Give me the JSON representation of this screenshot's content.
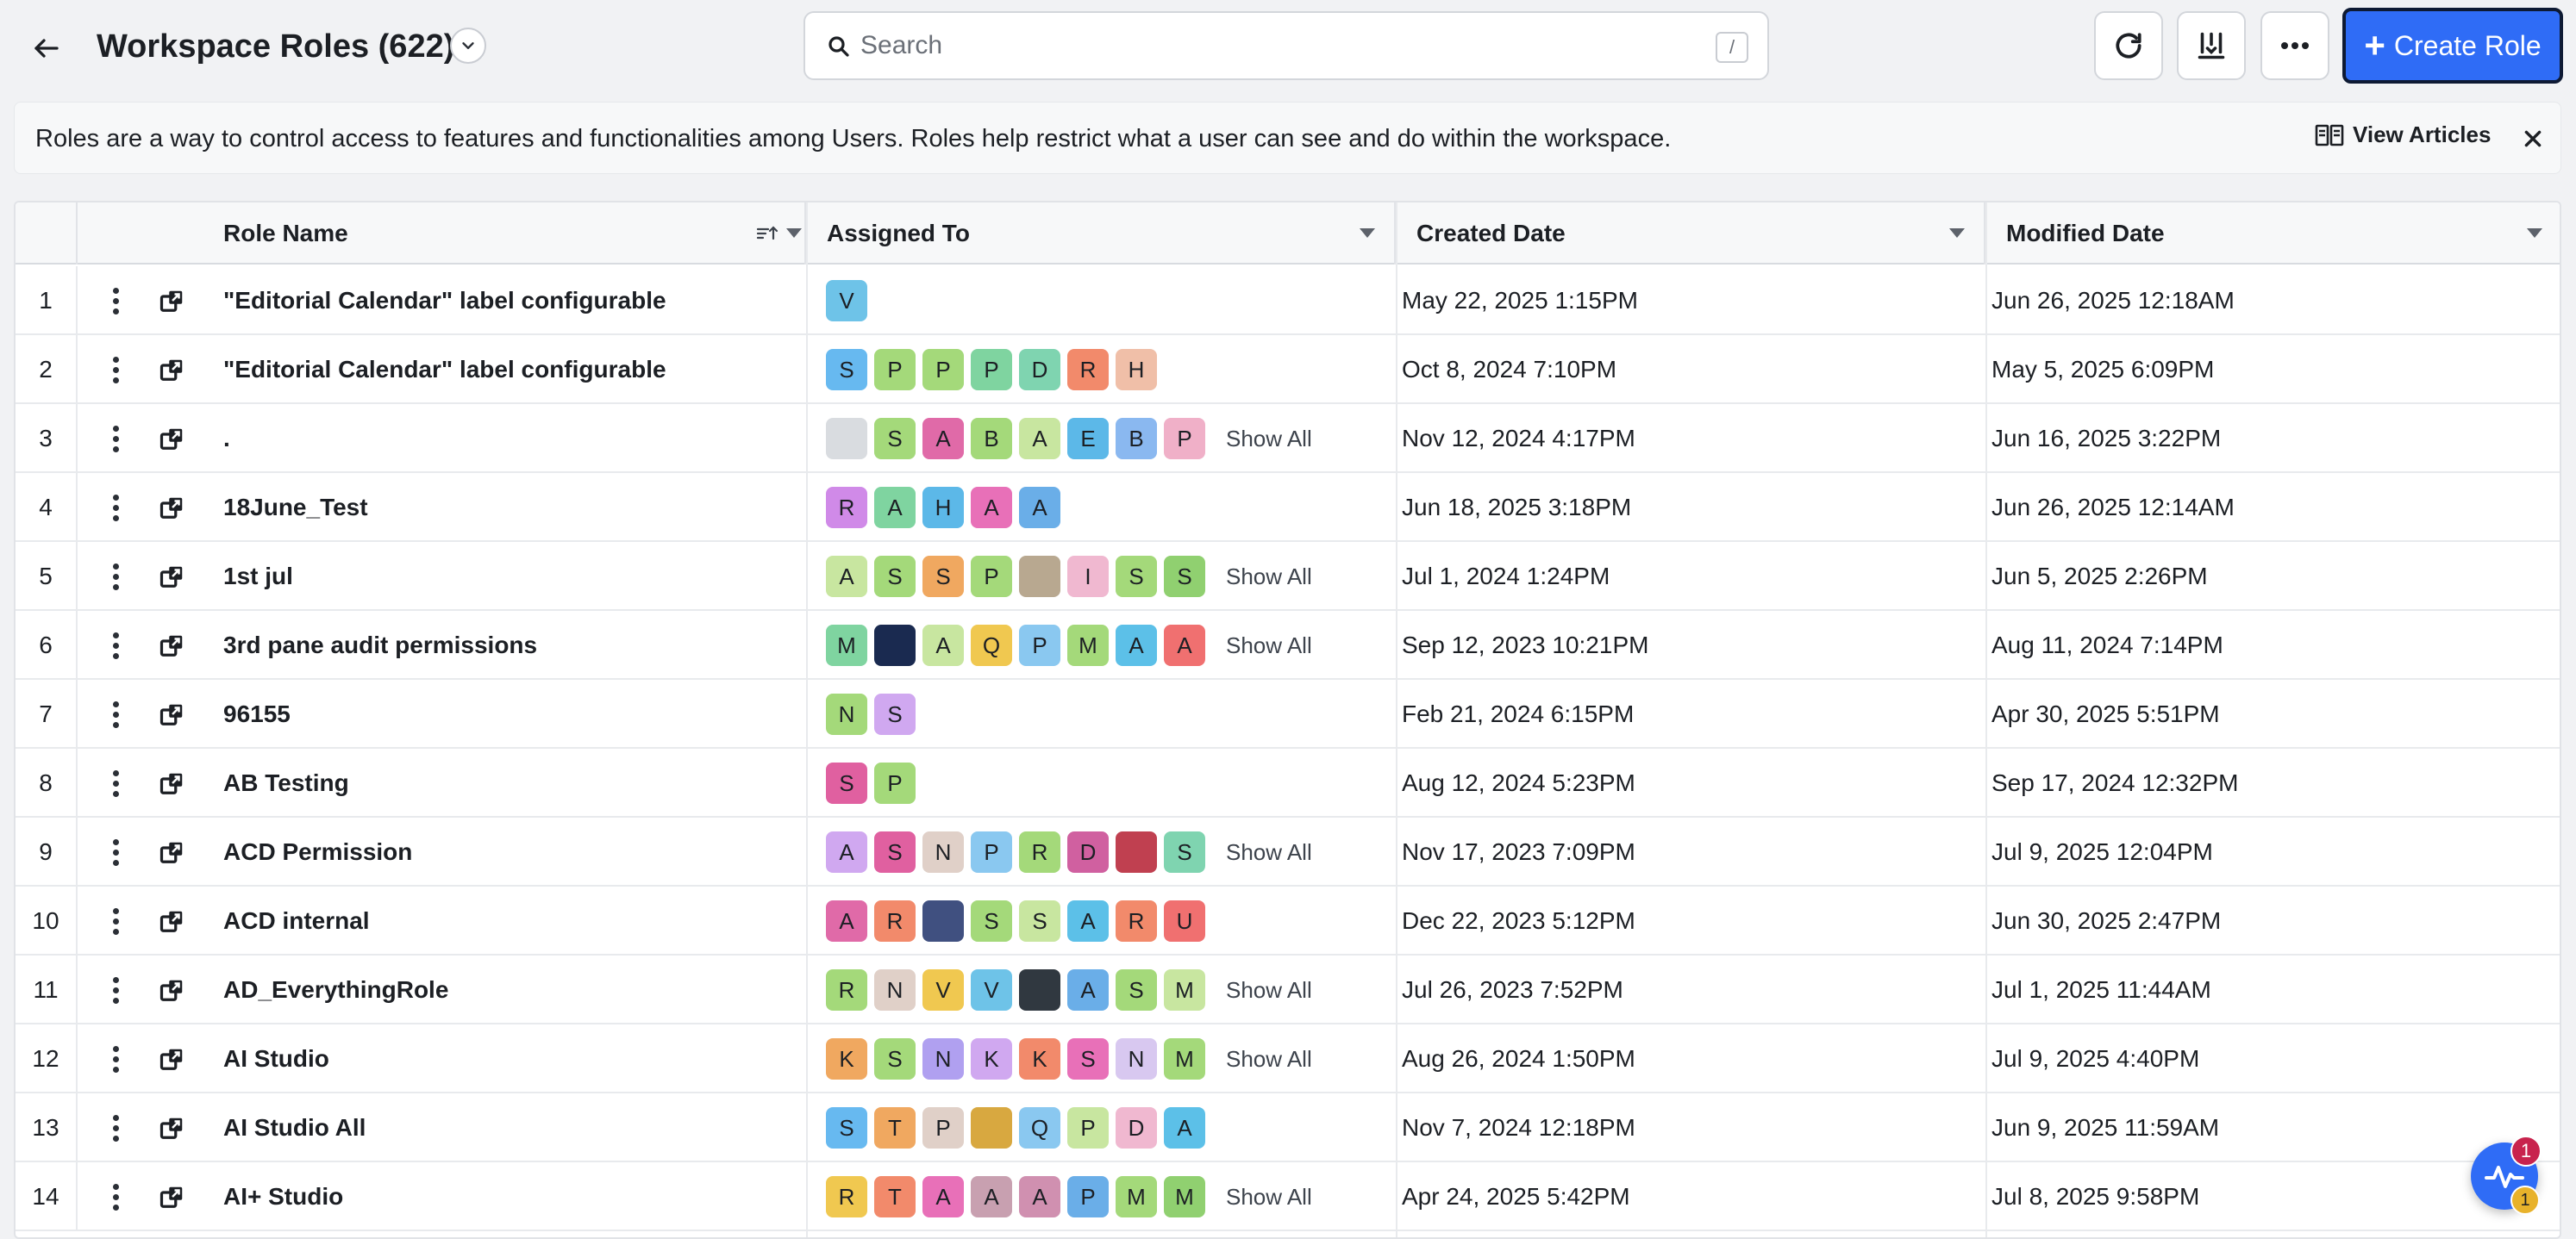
{
  "header": {
    "title": "Workspace Roles (622)",
    "search_placeholder": "Search",
    "search_shortcut": "/",
    "create_label": "Create Role"
  },
  "banner": {
    "text": "Roles are a way to control access to features and functionalities among Users. Roles help restrict what a user can see and do within the workspace.",
    "view_articles_label": "View Articles"
  },
  "table": {
    "columns": {
      "role_name": "Role Name",
      "assigned_to": "Assigned To",
      "created_date": "Created Date",
      "modified_date": "Modified Date"
    },
    "show_all_label": "Show All",
    "rows": [
      {
        "num": "1",
        "name": "\"Editorial Calendar\" label configurable",
        "created": "May 22, 2025 1:15PM",
        "modified": "Jun 26, 2025 12:18AM",
        "show_all": false,
        "avatars": [
          {
            "l": "V",
            "c": "#6ec3e8"
          }
        ]
      },
      {
        "num": "2",
        "name": "\"Editorial Calendar\" label configurable",
        "created": "Oct 8, 2024 7:10PM",
        "modified": "May 5, 2025 6:09PM",
        "show_all": false,
        "avatars": [
          {
            "l": "S",
            "c": "#67b9f0"
          },
          {
            "l": "P",
            "c": "#a4d97a"
          },
          {
            "l": "P",
            "c": "#a4d97a"
          },
          {
            "l": "P",
            "c": "#7fd4a0"
          },
          {
            "l": "D",
            "c": "#7fd4b0"
          },
          {
            "l": "R",
            "c": "#f28a6b"
          },
          {
            "l": "H",
            "c": "#f0bfa8"
          }
        ]
      },
      {
        "num": "3",
        "name": ".",
        "created": "Nov 12, 2024 4:17PM",
        "modified": "Jun 16, 2025 3:22PM",
        "show_all": true,
        "avatars": [
          {
            "l": "",
            "c": "#d9dce0",
            "img": true
          },
          {
            "l": "S",
            "c": "#a4d97a"
          },
          {
            "l": "A",
            "c": "#e06aa8"
          },
          {
            "l": "B",
            "c": "#a4d97a"
          },
          {
            "l": "A",
            "c": "#c8e6a0"
          },
          {
            "l": "E",
            "c": "#5cb8e8"
          },
          {
            "l": "B",
            "c": "#8ab8f0"
          },
          {
            "l": "P",
            "c": "#f0b0c8"
          }
        ]
      },
      {
        "num": "4",
        "name": "18June_Test",
        "created": "Jun 18, 2025 3:18PM",
        "modified": "Jun 26, 2025 12:14AM",
        "show_all": false,
        "avatars": [
          {
            "l": "R",
            "c": "#d08ae8"
          },
          {
            "l": "A",
            "c": "#7fd4a0"
          },
          {
            "l": "H",
            "c": "#5cb8e8"
          },
          {
            "l": "A",
            "c": "#e870b8"
          },
          {
            "l": "A",
            "c": "#6aaee8"
          }
        ]
      },
      {
        "num": "5",
        "name": "1st jul",
        "created": "Jul 1, 2024 1:24PM",
        "modified": "Jun 5, 2025 2:26PM",
        "show_all": true,
        "avatars": [
          {
            "l": "A",
            "c": "#c8e6a0"
          },
          {
            "l": "S",
            "c": "#a4d97a"
          },
          {
            "l": "S",
            "c": "#f0a860"
          },
          {
            "l": "P",
            "c": "#a4d97a"
          },
          {
            "l": "",
            "c": "#b8a890",
            "img": true
          },
          {
            "l": "I",
            "c": "#f0b8d0"
          },
          {
            "l": "S",
            "c": "#a4d97a"
          },
          {
            "l": "S",
            "c": "#90d070"
          }
        ]
      },
      {
        "num": "6",
        "name": "3rd pane audit permissions",
        "created": "Sep 12, 2023 10:21PM",
        "modified": "Aug 11, 2024 7:14PM",
        "show_all": true,
        "avatars": [
          {
            "l": "M",
            "c": "#7fd4a0"
          },
          {
            "l": "",
            "c": "#1a2a50",
            "img": true
          },
          {
            "l": "A",
            "c": "#c8e6a0"
          },
          {
            "l": "Q",
            "c": "#f0c850"
          },
          {
            "l": "P",
            "c": "#8ac8f0"
          },
          {
            "l": "M",
            "c": "#a4d97a"
          },
          {
            "l": "A",
            "c": "#5cc0e8"
          },
          {
            "l": "A",
            "c": "#f07070"
          }
        ]
      },
      {
        "num": "7",
        "name": "96155",
        "created": "Feb 21, 2024 6:15PM",
        "modified": "Apr 30, 2025 5:51PM",
        "show_all": false,
        "avatars": [
          {
            "l": "N",
            "c": "#a4d97a"
          },
          {
            "l": "S",
            "c": "#d0a8f0"
          }
        ]
      },
      {
        "num": "8",
        "name": "AB Testing",
        "created": "Aug 12, 2024 5:23PM",
        "modified": "Sep 17, 2024 12:32PM",
        "show_all": false,
        "avatars": [
          {
            "l": "S",
            "c": "#e060a0"
          },
          {
            "l": "P",
            "c": "#a4d97a"
          }
        ]
      },
      {
        "num": "9",
        "name": "ACD Permission",
        "created": "Nov 17, 2023 7:09PM",
        "modified": "Jul 9, 2025 12:04PM",
        "show_all": true,
        "avatars": [
          {
            "l": "A",
            "c": "#d0a8f0"
          },
          {
            "l": "S",
            "c": "#e060a0"
          },
          {
            "l": "N",
            "c": "#e0d0c8"
          },
          {
            "l": "P",
            "c": "#8ac8f0"
          },
          {
            "l": "R",
            "c": "#a4d97a"
          },
          {
            "l": "D",
            "c": "#d060a0"
          },
          {
            "l": "",
            "c": "#c04050",
            "img": true
          },
          {
            "l": "S",
            "c": "#7fd4b0"
          }
        ]
      },
      {
        "num": "10",
        "name": "ACD internal",
        "created": "Dec 22, 2023 5:12PM",
        "modified": "Jun 30, 2025 2:47PM",
        "show_all": false,
        "avatars": [
          {
            "l": "A",
            "c": "#e06aa8"
          },
          {
            "l": "R",
            "c": "#f28a6b"
          },
          {
            "l": "",
            "c": "#405080",
            "img": true
          },
          {
            "l": "S",
            "c": "#a4d97a"
          },
          {
            "l": "S",
            "c": "#c8e6a0"
          },
          {
            "l": "A",
            "c": "#5cc0e8"
          },
          {
            "l": "R",
            "c": "#f28a6b"
          },
          {
            "l": "U",
            "c": "#f07070"
          }
        ]
      },
      {
        "num": "11",
        "name": "AD_EverythingRole",
        "created": "Jul 26, 2023 7:52PM",
        "modified": "Jul 1, 2025 11:44AM",
        "show_all": true,
        "avatars": [
          {
            "l": "R",
            "c": "#a4d97a"
          },
          {
            "l": "N",
            "c": "#e0d0c8"
          },
          {
            "l": "V",
            "c": "#f0c850"
          },
          {
            "l": "V",
            "c": "#6ec3e8"
          },
          {
            "l": "",
            "c": "#303840",
            "img": true
          },
          {
            "l": "A",
            "c": "#6aaee8"
          },
          {
            "l": "S",
            "c": "#a4d97a"
          },
          {
            "l": "M",
            "c": "#c8e6a0"
          }
        ]
      },
      {
        "num": "12",
        "name": "AI Studio",
        "created": "Aug 26, 2024 1:50PM",
        "modified": "Jul 9, 2025 4:40PM",
        "show_all": true,
        "avatars": [
          {
            "l": "K",
            "c": "#f0a860"
          },
          {
            "l": "S",
            "c": "#a4d97a"
          },
          {
            "l": "N",
            "c": "#b0a0f0"
          },
          {
            "l": "K",
            "c": "#d0a8f0"
          },
          {
            "l": "K",
            "c": "#f28a6b"
          },
          {
            "l": "S",
            "c": "#e870b8"
          },
          {
            "l": "N",
            "c": "#d8c8f0"
          },
          {
            "l": "M",
            "c": "#a4d97a"
          }
        ]
      },
      {
        "num": "13",
        "name": "AI Studio All",
        "created": "Nov 7, 2024 12:18PM",
        "modified": "Jun 9, 2025 11:59AM",
        "show_all": false,
        "avatars": [
          {
            "l": "S",
            "c": "#67b9f0"
          },
          {
            "l": "T",
            "c": "#f0a860"
          },
          {
            "l": "P",
            "c": "#e0d0c8"
          },
          {
            "l": "",
            "c": "#d8a840",
            "img": true
          },
          {
            "l": "Q",
            "c": "#8ac8f0"
          },
          {
            "l": "P",
            "c": "#c8e6a0"
          },
          {
            "l": "D",
            "c": "#f0b8d0"
          },
          {
            "l": "A",
            "c": "#5cc0e8"
          }
        ]
      },
      {
        "num": "14",
        "name": "AI+ Studio",
        "created": "Apr 24, 2025 5:42PM",
        "modified": "Jul 8, 2025 9:58PM",
        "show_all": true,
        "avatars": [
          {
            "l": "R",
            "c": "#f0c850"
          },
          {
            "l": "T",
            "c": "#f28a6b"
          },
          {
            "l": "A",
            "c": "#e870b8"
          },
          {
            "l": "A",
            "c": "#c8a0b0"
          },
          {
            "l": "A",
            "c": "#d090b0"
          },
          {
            "l": "P",
            "c": "#6aaee8"
          },
          {
            "l": "M",
            "c": "#a4d97a"
          },
          {
            "l": "M",
            "c": "#90d070"
          }
        ]
      }
    ]
  },
  "fab": {
    "badge_top": "1",
    "badge_bottom": "1"
  },
  "colors": {
    "accent": "#2f6cf6",
    "badge_red": "#c8234d",
    "badge_yellow": "#e8b22b"
  }
}
